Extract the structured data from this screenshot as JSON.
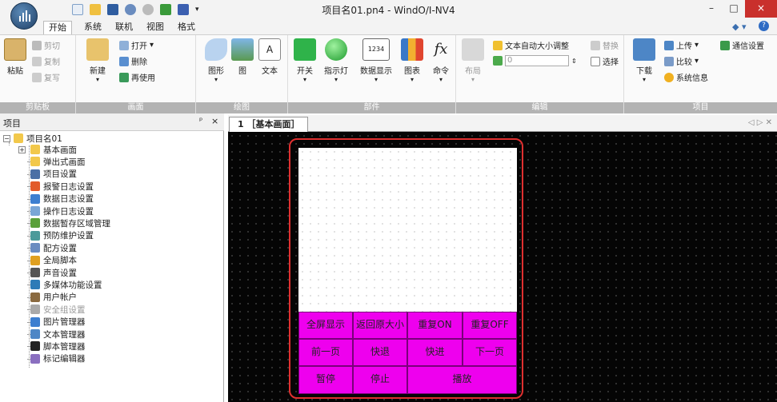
{
  "window": {
    "title": "项目名01.pn4 - WindO/I-NV4",
    "minimize": "–",
    "maximize": "□",
    "close": "×"
  },
  "tabs": [
    "开始",
    "系统",
    "联机",
    "视图",
    "格式"
  ],
  "ribbon": {
    "clipboard": {
      "paste": "粘贴",
      "cut": "剪切",
      "copy": "复制",
      "format_copy": "复写",
      "label": "剪贴板"
    },
    "screen": {
      "new": "新建",
      "open": "打开",
      "delete": "删除",
      "reuse": "再使用",
      "label": "画面"
    },
    "draw": {
      "shape": "图形",
      "picture": "图",
      "text": "文本",
      "label": "绘图"
    },
    "parts": {
      "switch": "开关",
      "lamp": "指示灯",
      "data_display_icon": "1234",
      "data_display": "数据显示",
      "chart": "图表",
      "command_icon": "fx",
      "command": "命令",
      "label": "部件"
    },
    "edit": {
      "layout": "布局",
      "auto_text_resize": "文本自动大小调整",
      "number_value": "0",
      "replace": "替换",
      "select": "选择",
      "label": "编辑"
    },
    "project": {
      "download": "下载",
      "upload": "上传",
      "compare": "比较",
      "sysinfo": "系统信息",
      "comm_settings": "通信设置",
      "label": "项目"
    }
  },
  "panel": {
    "title": "项目",
    "pin": "ᵖ",
    "close": "×"
  },
  "tree": {
    "root": "项目名01",
    "items": [
      "基本画面",
      "弹出式画面",
      "项目设置",
      "报警日志设置",
      "数据日志设置",
      "操作日志设置",
      "数据暂存区域管理",
      "预防维护设置",
      "配方设置",
      "全局脚本",
      "声音设置",
      "多媒体功能设置",
      "用户帐户",
      "安全组设置",
      "图片管理器",
      "文本管理器",
      "脚本管理器",
      "标记编辑器"
    ]
  },
  "document": {
    "tab": "1 ［基本画面］",
    "scroll_arrows": "◁ ▷ ✕"
  },
  "hmi_buttons": {
    "row1": [
      "全屏显示",
      "返回原大小",
      "重复ON",
      "重复OFF"
    ],
    "row2": [
      "前一页",
      "快退",
      "快进",
      "下一页"
    ],
    "row3": [
      "暂停",
      "停止",
      "播放"
    ]
  },
  "colors": {
    "button_fill": "#ee00ee",
    "highlight": "#e03030",
    "canvas": "#050505"
  }
}
